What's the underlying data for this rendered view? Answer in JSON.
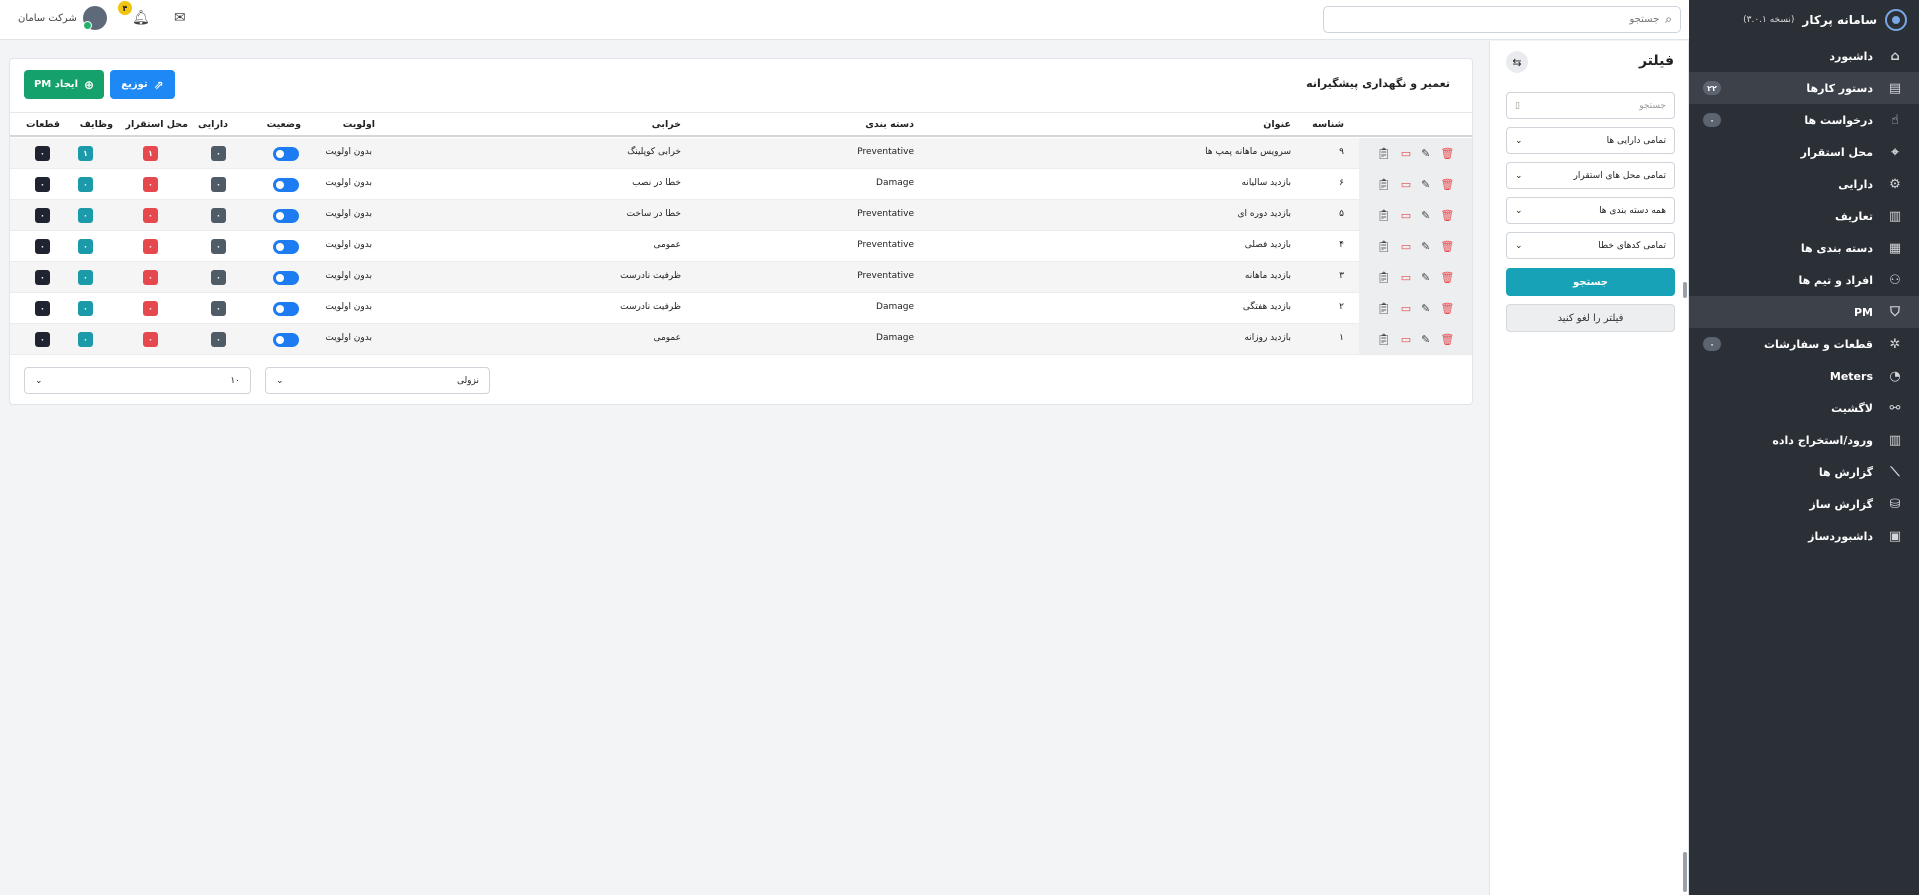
{
  "app": {
    "title": "سامانه پرکار",
    "version": "(نسخه ۳.۰.۱)"
  },
  "sidebar": {
    "items": [
      {
        "label": "داشبورد",
        "icon": "home-icon",
        "glyph": "⌂",
        "badge": ""
      },
      {
        "label": "دستور کارها",
        "icon": "clipboard-icon",
        "glyph": "▤",
        "badge": "۲۲",
        "active": true
      },
      {
        "label": "درخواست ها",
        "icon": "hand-icon",
        "glyph": "☝",
        "badge": "۰"
      },
      {
        "label": "محل استقرار",
        "icon": "location-icon",
        "glyph": "⌖",
        "badge": ""
      },
      {
        "label": "دارایی",
        "icon": "asset-icon",
        "glyph": "⚙",
        "badge": ""
      },
      {
        "label": "تعاریف",
        "icon": "book-icon",
        "glyph": "▥",
        "badge": ""
      },
      {
        "label": "دسته بندی ها",
        "icon": "grid-icon",
        "glyph": "▦",
        "badge": ""
      },
      {
        "label": "افراد و تیم ها",
        "icon": "users-icon",
        "glyph": "⚇",
        "badge": ""
      },
      {
        "label": "PM",
        "icon": "shield-icon",
        "glyph": "⛉",
        "badge": "",
        "active": true
      },
      {
        "label": "قطعات و سفارشات",
        "icon": "cog-icon",
        "glyph": "✲",
        "badge": "۰"
      },
      {
        "label": "Meters",
        "icon": "gauge-icon",
        "glyph": "◔",
        "badge": ""
      },
      {
        "label": "لاگشیت",
        "icon": "log-icon",
        "glyph": "⚯",
        "badge": ""
      },
      {
        "label": "ورود/استخراج داده",
        "icon": "import-export-icon",
        "glyph": "▥",
        "badge": ""
      },
      {
        "label": "گزارش ها",
        "icon": "chart-icon",
        "glyph": "⟋",
        "badge": ""
      },
      {
        "label": "گزارش ساز",
        "icon": "database-icon",
        "glyph": "⛁",
        "badge": ""
      },
      {
        "label": "داشبوردساز",
        "icon": "layout-icon",
        "glyph": "▣",
        "badge": ""
      }
    ]
  },
  "topbar": {
    "search_placeholder": "جستجو",
    "company": "شرکت سامان",
    "notifications": "۴"
  },
  "filter": {
    "title": "فیلتر",
    "search_placeholder": "جستجو",
    "assets": "تمامی دارایی ها",
    "locations": "تمامی محل های استقرار",
    "categories": "همه دسته بندی ها",
    "codes": "تمامی کدهای خطا",
    "search_button": "جستجو",
    "clear_button": "فیلتر را لغو کنید",
    "colors": {
      "primary": "#17a2b8"
    }
  },
  "main": {
    "title": "تعمیر و نگهداری پیشگیرانه",
    "create_button": "ایجاد PM",
    "distribute_button": "توزیع",
    "columns": {
      "id": "شناسه",
      "title": "عنوان",
      "category": "دسته بندی",
      "failure": "خرابی",
      "priority": "اولویت",
      "status": "وضعیت",
      "asset": "دارایی",
      "location": "محل استقرار",
      "tasks": "وظایف",
      "parts": "قطعات"
    },
    "rows": [
      {
        "id": "۹",
        "title": "سرویس ماهانه پمپ ها",
        "category": "Preventative",
        "failure": "خرابی کوپلینگ",
        "priority": "بدون اولویت",
        "asset": "۰",
        "location": "۱",
        "tasks": "۱",
        "parts": "۰"
      },
      {
        "id": "۶",
        "title": "بازدید سالیانه",
        "category": "Damage",
        "failure": "خطا در نصب",
        "priority": "بدون اولویت",
        "asset": "۰",
        "location": "۰",
        "tasks": "۰",
        "parts": "۰"
      },
      {
        "id": "۵",
        "title": "بازدید دوره ای",
        "category": "Preventative",
        "failure": "خطا در ساخت",
        "priority": "بدون اولویت",
        "asset": "۰",
        "location": "۰",
        "tasks": "۰",
        "parts": "۰"
      },
      {
        "id": "۴",
        "title": "بازدید فصلی",
        "category": "Preventative",
        "failure": "عمومی",
        "priority": "بدون اولویت",
        "asset": "۰",
        "location": "۰",
        "tasks": "۰",
        "parts": "۰"
      },
      {
        "id": "۳",
        "title": "بازدید ماهانه",
        "category": "Preventative",
        "failure": "ظرفیت نادرست",
        "priority": "بدون اولویت",
        "asset": "۰",
        "location": "۰",
        "tasks": "۰",
        "parts": "۰"
      },
      {
        "id": "۲",
        "title": "بازدید هفتگی",
        "category": "Damage",
        "failure": "ظرفیت نادرست",
        "priority": "بدون اولویت",
        "asset": "۰",
        "location": "۰",
        "tasks": "۰",
        "parts": "۰"
      },
      {
        "id": "۱",
        "title": "بازدید روزانه",
        "category": "Damage",
        "failure": "عمومی",
        "priority": "بدون اولویت",
        "asset": "۰",
        "location": "۰",
        "tasks": "۰",
        "parts": "۰"
      }
    ],
    "sort_select": "نزولی",
    "page_size": "۱۰",
    "colors": {
      "asset": "#4f5b66",
      "location": "#e5484d",
      "tasks": "#1b9aaa",
      "parts": "#1f2430"
    }
  }
}
